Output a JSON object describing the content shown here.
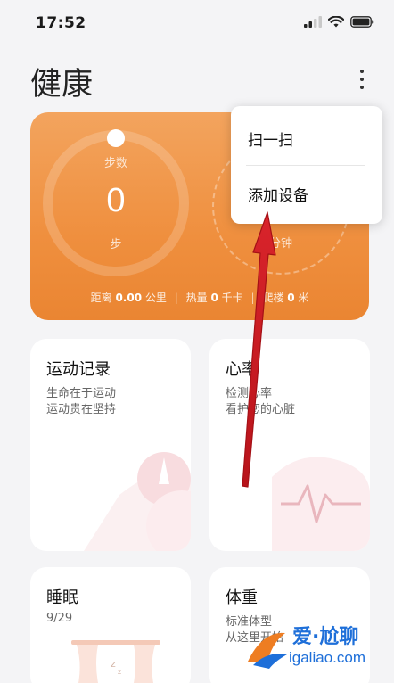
{
  "status_bar": {
    "time": "17:52"
  },
  "header": {
    "title": "健康"
  },
  "summary": {
    "steps_label": "步数",
    "steps_value": "0",
    "steps_unit": "步",
    "minutes_unit": "分钟",
    "distance_label": "距离",
    "distance_value": "0.00",
    "distance_unit": "公里",
    "calories_label": "热量",
    "calories_value": "0",
    "calories_unit": "千卡",
    "floors_label": "爬楼",
    "floors_value": "0",
    "floors_unit": "米",
    "accent": "#ef8f3e"
  },
  "menu": {
    "items": [
      {
        "label": "扫一扫"
      },
      {
        "label": "添加设备"
      }
    ]
  },
  "tiles": {
    "exercise": {
      "title": "运动记录",
      "line1": "生命在于运动",
      "line2": "运动贵在坚持"
    },
    "heart_rate": {
      "title": "心率",
      "line1": "检测心率",
      "line2": "看护您的心脏"
    },
    "sleep": {
      "title": "睡眠",
      "line1": "9/29"
    },
    "weight": {
      "title": "体重",
      "line1": "标准体型",
      "line2": "从这里开始"
    }
  },
  "watermark": {
    "name": "爱·尬聊",
    "url": "igaliao.com"
  }
}
